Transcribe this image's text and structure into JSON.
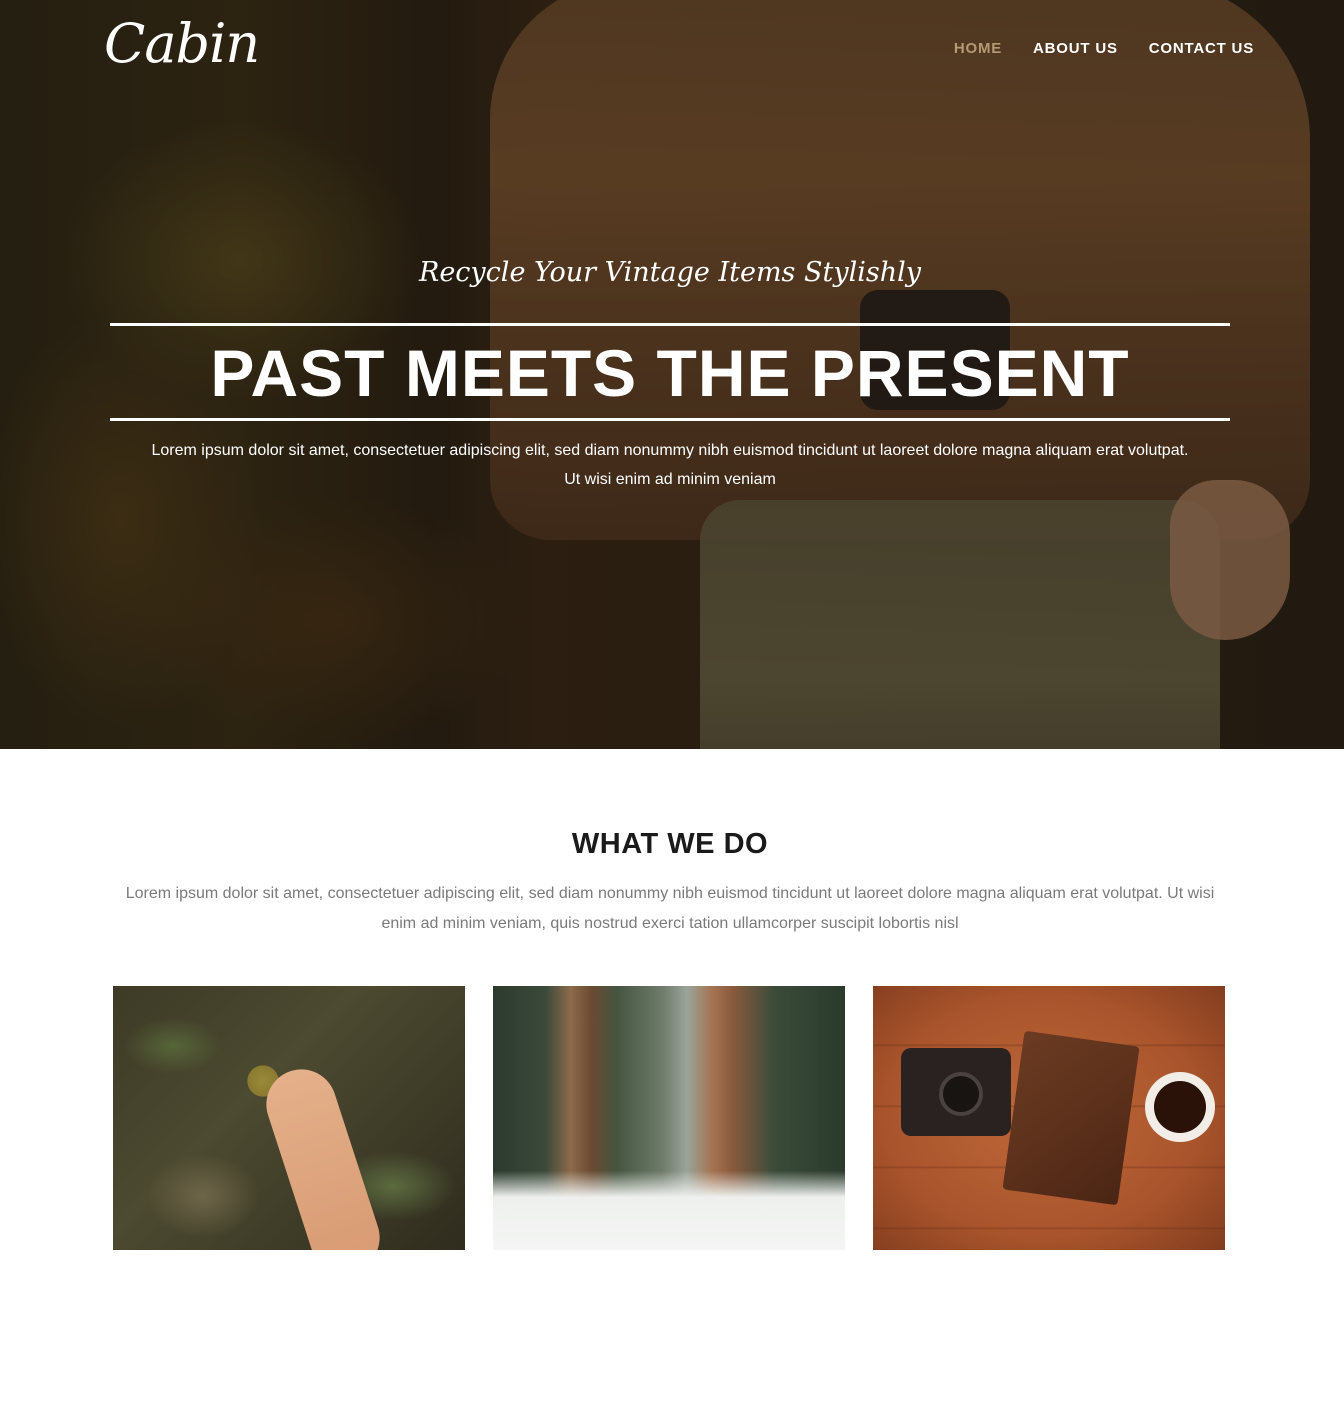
{
  "brand": {
    "logo_text": "Cabin"
  },
  "nav": {
    "items": [
      {
        "label": "HOME",
        "active": true
      },
      {
        "label": "ABOUT US",
        "active": false
      },
      {
        "label": "CONTACT US",
        "active": false
      }
    ],
    "active_color": "#b49a73"
  },
  "hero": {
    "tagline": "Recycle Your Vintage Items Stylishly",
    "headline": "PAST MEETS THE PRESENT",
    "body": "Lorem ipsum dolor sit amet, consectetuer adipiscing elit, sed diam nonummy nibh euismod tincidunt ut laoreet dolore magna aliquam erat volutpat. Ut wisi enim ad minim veniam"
  },
  "what_we_do": {
    "title": "WHAT WE DO",
    "body": "Lorem ipsum dolor sit amet, consectetuer adipiscing elit, sed diam nonummy nibh euismod tincidunt ut laoreet dolore magna aliquam erat volutpat. Ut wisi enim ad minim veniam, quis nostrud exerci tation ullamcorper suscipit lobortis nisl"
  },
  "gallery": {
    "images": [
      {
        "name": "hand-picking-fruit-photo"
      },
      {
        "name": "redwood-forest-snow-photo"
      },
      {
        "name": "camera-notebook-coffee-photo"
      }
    ]
  }
}
